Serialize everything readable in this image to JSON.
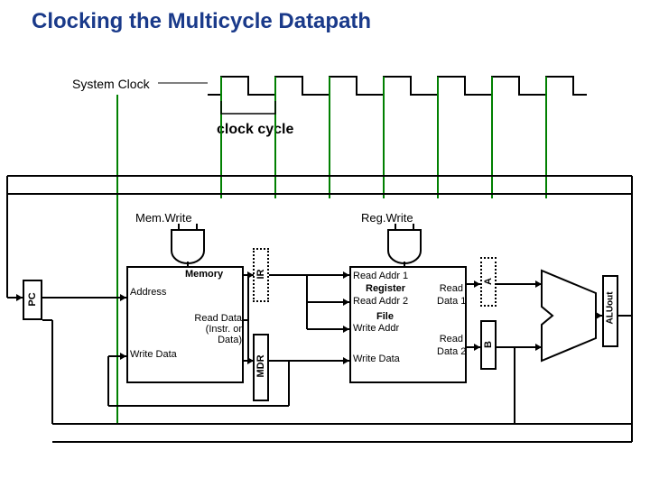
{
  "title": "Clocking the Multicycle Datapath",
  "labels": {
    "system_clock": "System Clock",
    "clock_cycle": "clock cycle",
    "memwrite": "Mem.Write",
    "regwrite": "Reg.Write"
  },
  "registers": {
    "pc": "PC",
    "ir": "IR",
    "mdr": "MDR",
    "a": "A",
    "b": "B",
    "aluout": "ALUout"
  },
  "memory": {
    "title": "Memory",
    "address": "Address",
    "read_data": "Read Data (Instr. or Data)",
    "write_data": "Write Data"
  },
  "regfile": {
    "read_addr1": "Read Addr 1",
    "register": "Register",
    "read": "Read",
    "read_addr2": "Read Addr 2",
    "data1": "Data 1",
    "file": "File",
    "write_addr": "Write Addr",
    "read2": "Read",
    "data2": "Data 2",
    "write_data": "Write Data"
  },
  "alu": "ALU",
  "colors": {
    "title": "#1a3a8a",
    "clock_vertical": "#008000",
    "waveform": "#000000"
  }
}
